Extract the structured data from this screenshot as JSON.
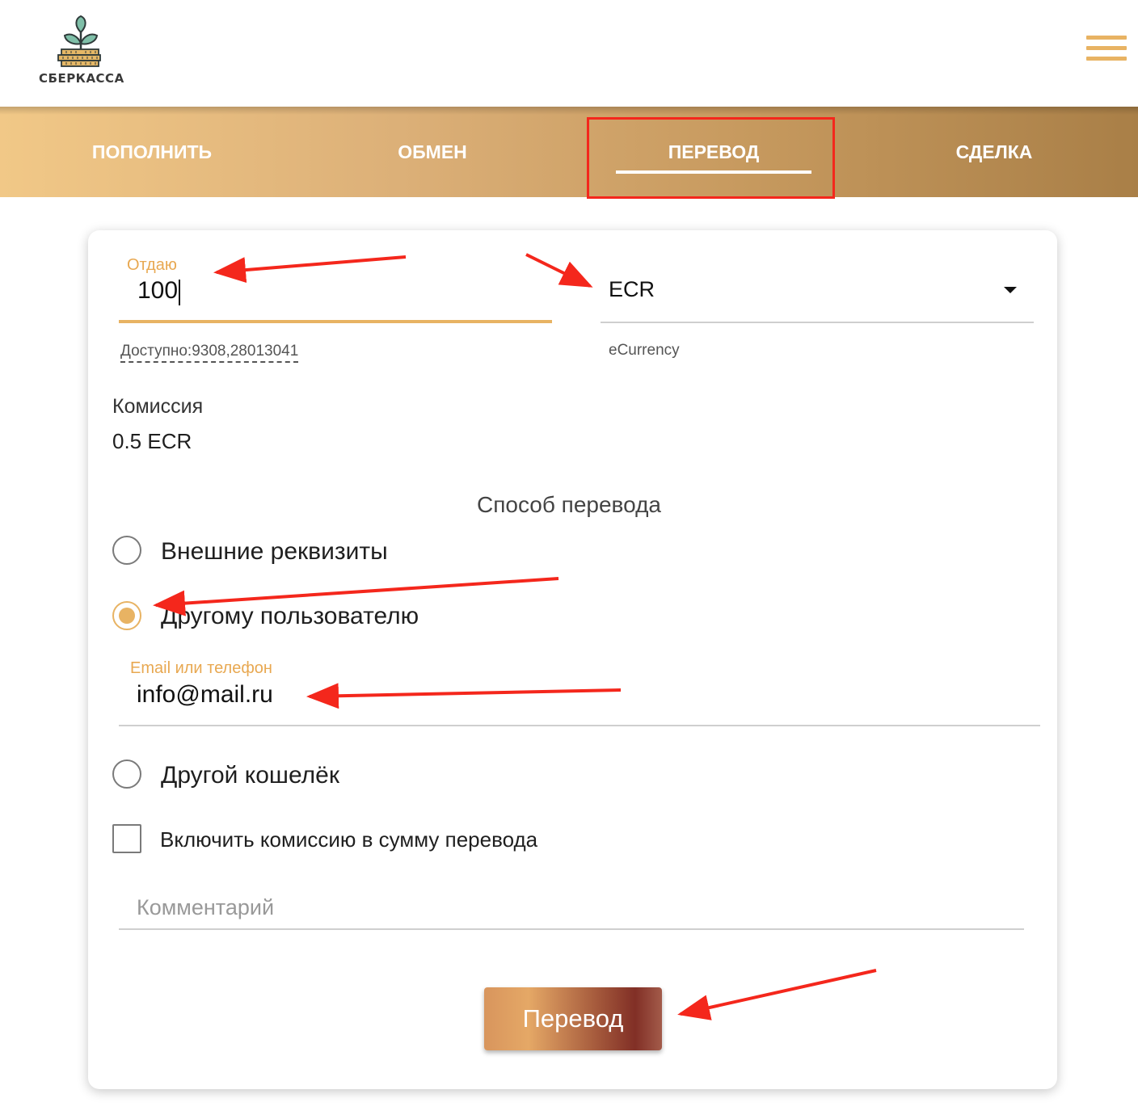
{
  "header": {
    "logo_text": "СБЕРКАССА"
  },
  "tabs": [
    {
      "label": "ПОПОЛНИТЬ"
    },
    {
      "label": "ОБМЕН"
    },
    {
      "label": "ПЕРЕВОД",
      "active": true
    },
    {
      "label": "СДЕЛКА"
    }
  ],
  "form": {
    "give_label": "Отдаю",
    "give_value": "100",
    "available": "Доступно:9308,28013041",
    "currency_value": "ECR",
    "currency_caption": "eCurrency",
    "commission_label": "Комиссия",
    "commission_value": "0.5 ECR",
    "method_title": "Способ перевода",
    "methods": [
      {
        "label": "Внешние реквизиты",
        "checked": false
      },
      {
        "label": "Другому пользователю",
        "checked": true
      },
      {
        "label": "Другой кошелёк",
        "checked": false
      }
    ],
    "recipient_label": "Email или телефон",
    "recipient_value": "info@mail.ru",
    "include_fee_label": "Включить комиссию в сумму перевода",
    "include_fee_checked": false,
    "comment_placeholder": "Комментарий",
    "submit_label": "Перевод"
  },
  "colors": {
    "accent": "#e8b363",
    "annotation": "#f4271c"
  },
  "icons": [
    "plant-logo-icon",
    "hamburger-menu-icon",
    "dropdown-arrow-icon"
  ]
}
